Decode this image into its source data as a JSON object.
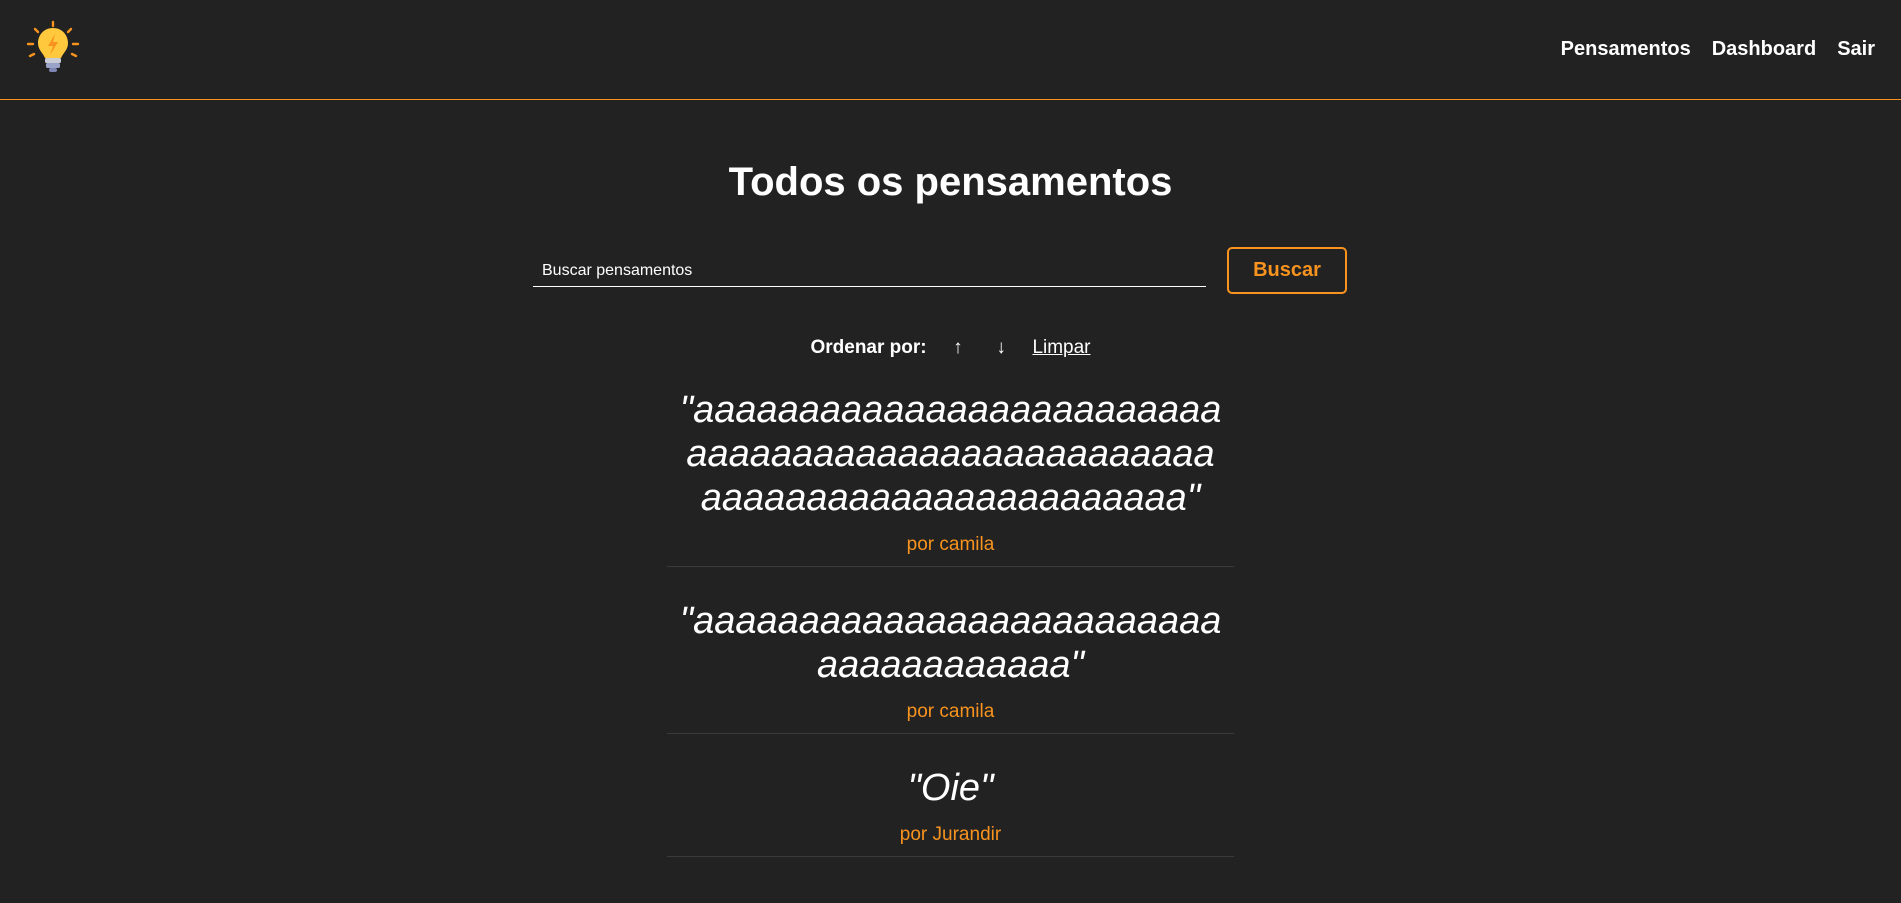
{
  "nav": {
    "logo_icon": "lightbulb-icon",
    "links": [
      "Pensamentos",
      "Dashboard",
      "Sair"
    ]
  },
  "main": {
    "title": "Todos os pensamentos",
    "search": {
      "placeholder": "Buscar pensamentos",
      "value": "",
      "button_label": "Buscar"
    },
    "order": {
      "label": "Ordenar por:",
      "asc_icon": "↑",
      "desc_icon": "↓",
      "clear_label": "Limpar"
    },
    "thoughts": [
      {
        "text": "\"aaaaaaaaaaaaaaaaaaaaaaaaaaaaaaaaaaaaaaaaaaaaaaaaaaaaaaaaaaaaaaaaaaaaaaaaa\"",
        "author": "por camila"
      },
      {
        "text": "\"aaaaaaaaaaaaaaaaaaaaaaaaaaaaaaaaaaaaa\"",
        "author": "por camila"
      },
      {
        "text": "\"Oie\"",
        "author": "por Jurandir"
      }
    ]
  },
  "colors": {
    "background": "#222222",
    "accent": "#f7931e",
    "text": "#ffffff"
  }
}
